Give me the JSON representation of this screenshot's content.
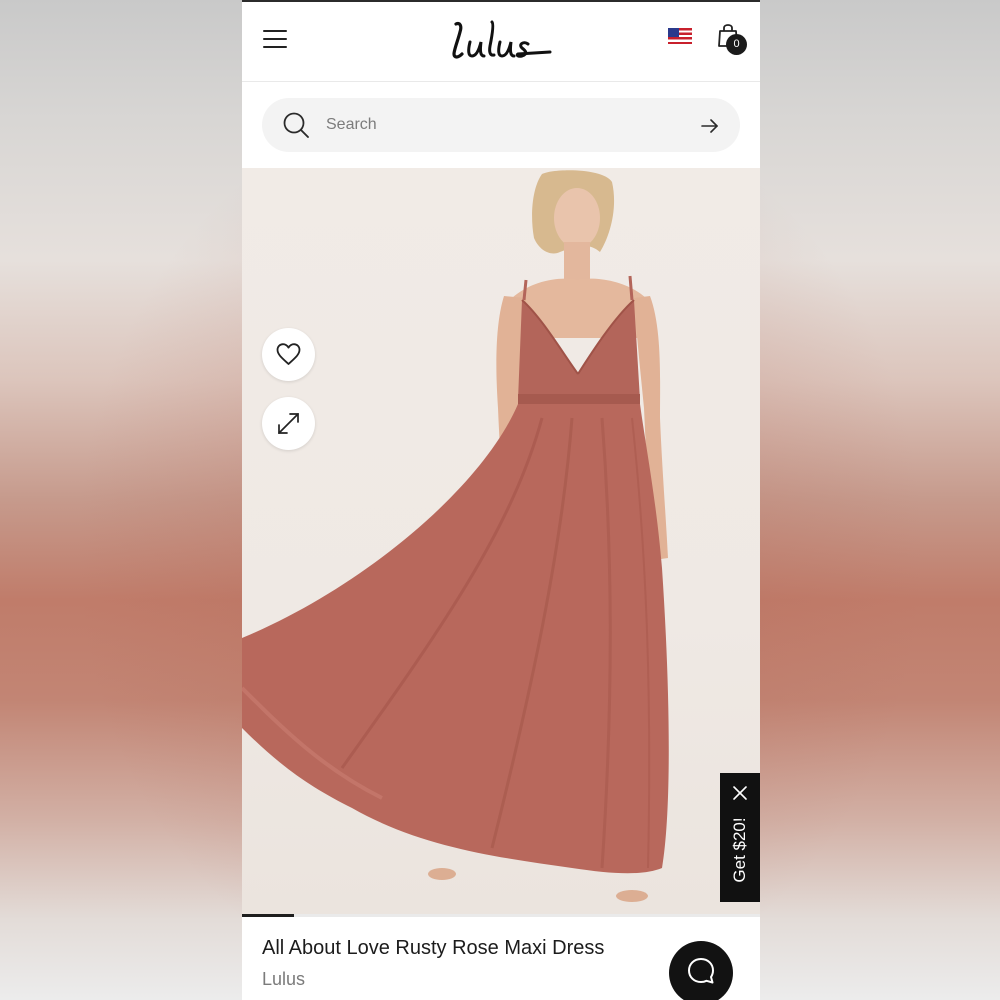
{
  "header": {
    "logo_text": "Lulus",
    "flag_icon": "us-flag-icon",
    "cart_count": "0"
  },
  "search": {
    "placeholder": "Search"
  },
  "gallery": {
    "image_description_icon": "product-photo",
    "position_progress": 0.1
  },
  "promo": {
    "label": "Get $20!"
  },
  "product": {
    "title": "All About Love Rusty Rose Maxi Dress",
    "brand": "Lulus"
  },
  "colors": {
    "dress": "#b3655a",
    "background": "#efe9e4",
    "dark": "#111111"
  }
}
